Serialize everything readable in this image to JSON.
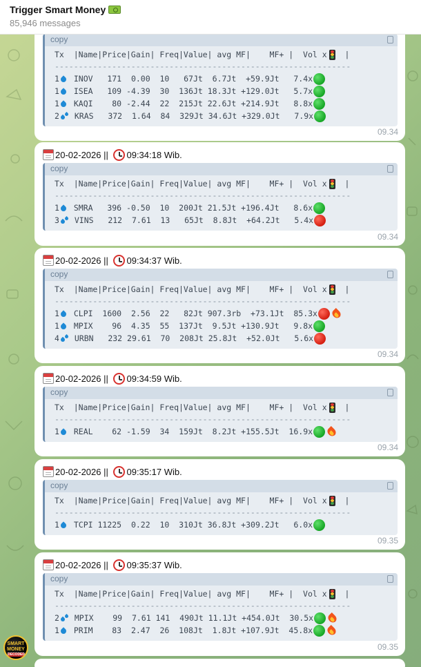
{
  "header": {
    "title": "Trigger Smart Money",
    "subtitle": "85,946 messages"
  },
  "copy_label": "copy",
  "table_header": "Tx  |Name|Price|Gain| Freq|Value| avg MF|    MF+ |  Vol x",
  "header_end": "  |",
  "divider": "--------------------------------------------------------------",
  "avatar": {
    "line1": "SMART",
    "line2": "MONEY",
    "line3": "DECODED"
  },
  "messages": [
    {
      "date": "",
      "time": "",
      "timestamp": "09.34",
      "rows": [
        {
          "tx": "1",
          "icon": "drop",
          "text": " INOV   171  0.00  10   67Jt  6.7Jt  +59.9Jt   7.4x",
          "signal": "green",
          "fire": false
        },
        {
          "tx": "1",
          "icon": "drop",
          "text": " ISEA   109 -4.39  30  136Jt 18.3Jt +129.0Jt   5.7x",
          "signal": "green",
          "fire": false
        },
        {
          "tx": "1",
          "icon": "drop",
          "text": " KAQI    80 -2.44  22  215Jt 22.6Jt +214.9Jt   8.8x",
          "signal": "green",
          "fire": false
        },
        {
          "tx": "2",
          "icon": "splash",
          "text": " KRAS   372  1.64  84  329Jt 34.6Jt +329.0Jt   7.9x",
          "signal": "green",
          "fire": false
        }
      ]
    },
    {
      "date": "20-02-2026",
      "sep": " || ",
      "time": "09:34:18 Wib.",
      "timestamp": "09.34",
      "rows": [
        {
          "tx": "1",
          "icon": "drop",
          "text": " SMRA   396 -0.50  10  200Jt 21.5Jt +196.4Jt   8.6x",
          "signal": "green",
          "fire": false
        },
        {
          "tx": "3",
          "icon": "splash",
          "text": " VINS   212  7.61  13   65Jt  8.8Jt  +64.2Jt   5.4x",
          "signal": "red",
          "fire": false
        }
      ]
    },
    {
      "date": "20-02-2026",
      "sep": " || ",
      "time": "09:34:37 Wib.",
      "timestamp": "09.34",
      "rows": [
        {
          "tx": "1",
          "icon": "drop",
          "text": " CLPI  1600  2.56  22   82Jt 907.3rb  +73.1Jt  85.3x",
          "signal": "red",
          "fire": true
        },
        {
          "tx": "1",
          "icon": "drop",
          "text": " MPIX    96  4.35  55  137Jt  9.5Jt +130.9Jt   9.8x",
          "signal": "green",
          "fire": false
        },
        {
          "tx": "4",
          "icon": "splash",
          "text": " URBN   232 29.61  70  208Jt 25.8Jt  +52.0Jt   5.6x",
          "signal": "red",
          "fire": false
        }
      ]
    },
    {
      "date": "20-02-2026",
      "sep": " || ",
      "time": "09:34:59 Wib.",
      "timestamp": "09.34",
      "rows": [
        {
          "tx": "1",
          "icon": "drop",
          "text": " REAL    62 -1.59  34  159Jt  8.2Jt +155.5Jt  16.9x",
          "signal": "green",
          "fire": true
        }
      ]
    },
    {
      "date": "20-02-2026",
      "sep": " || ",
      "time": "09:35:17 Wib.",
      "timestamp": "09.35",
      "rows": [
        {
          "tx": "1",
          "icon": "drop",
          "text": " TCPI 11225  0.22  10  310Jt 36.8Jt +309.2Jt   6.0x",
          "signal": "green",
          "fire": false
        }
      ]
    },
    {
      "date": "20-02-2026",
      "sep": " || ",
      "time": "09:35:37 Wib.",
      "timestamp": "09.35",
      "rows": [
        {
          "tx": "2",
          "icon": "splash",
          "text": " MPIX    99  7.61 141  490Jt 11.1Jt +454.0Jt  30.5x",
          "signal": "green",
          "fire": true
        },
        {
          "tx": "1",
          "icon": "drop",
          "text": " PRIM    83  2.47  26  108Jt  1.8Jt +107.9Jt  45.8x",
          "signal": "green",
          "fire": true
        }
      ]
    }
  ]
}
